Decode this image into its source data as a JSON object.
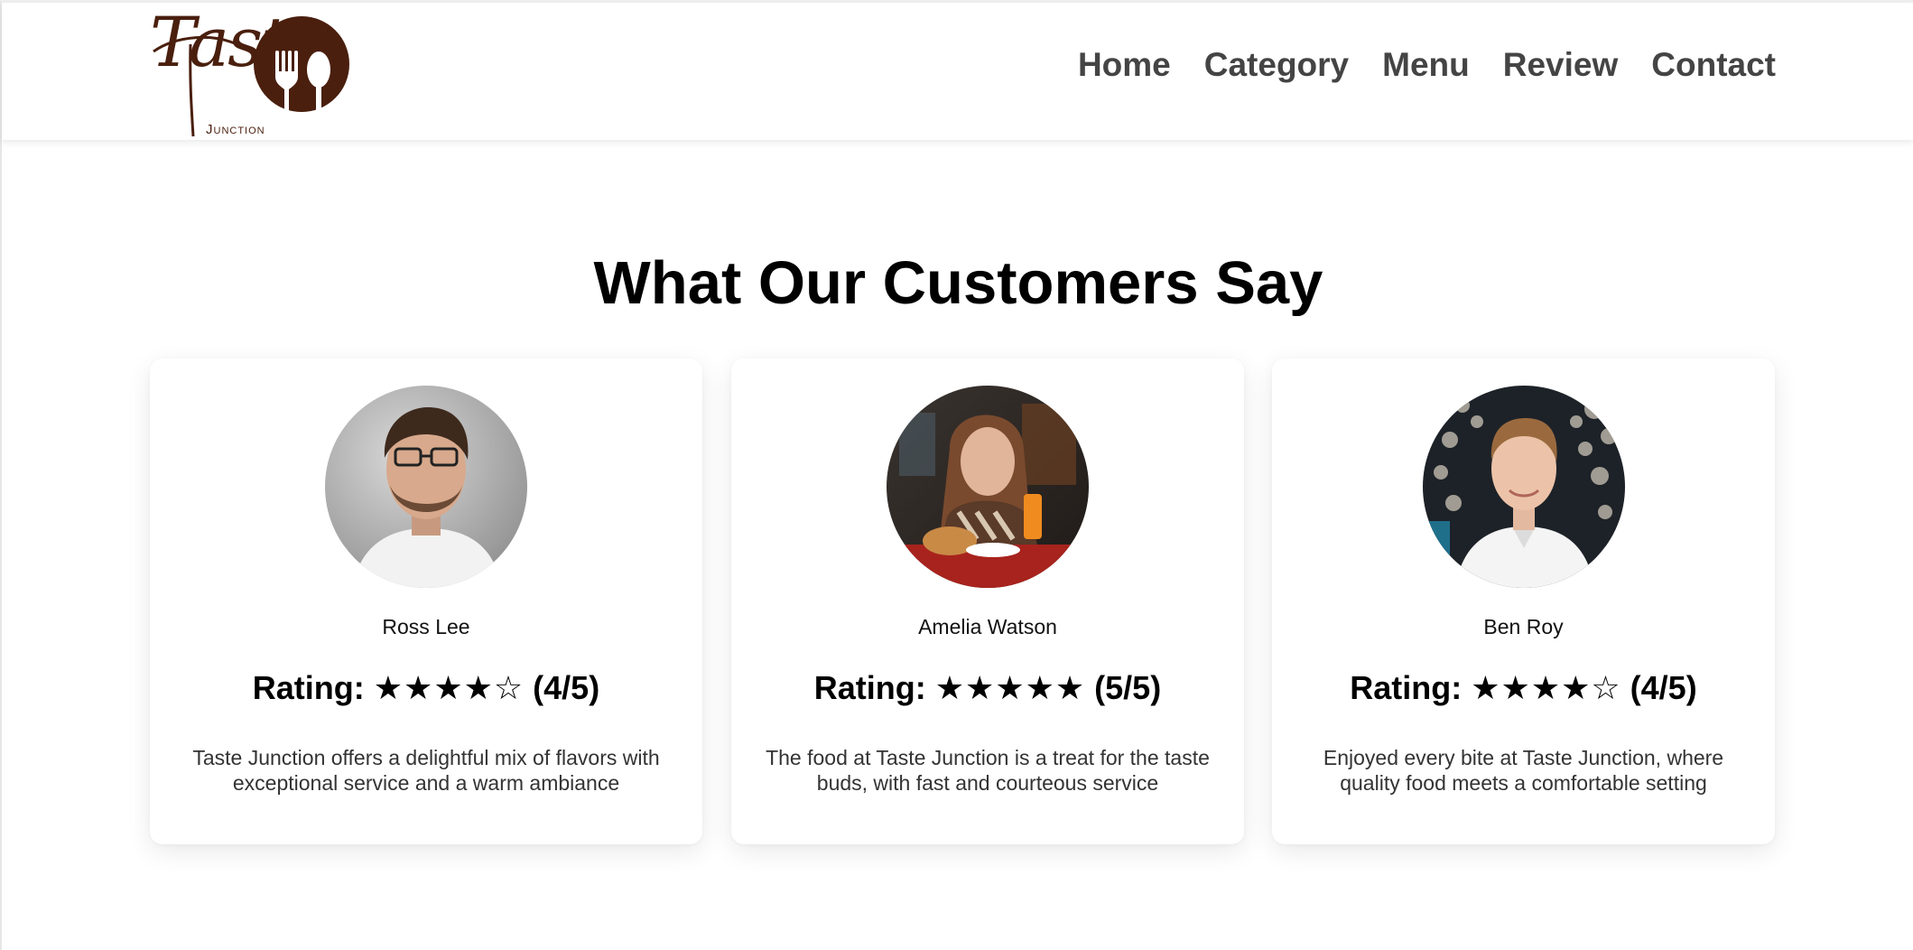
{
  "brand": {
    "logo_word": "Taste",
    "logo_sub": "Junction",
    "logo_color": "#4a1f0e",
    "logo_icon": "fork-and-spoon-icon"
  },
  "nav": {
    "items": [
      {
        "label": "Home"
      },
      {
        "label": "Category"
      },
      {
        "label": "Menu"
      },
      {
        "label": "Review"
      },
      {
        "label": "Contact"
      }
    ]
  },
  "section": {
    "title": "What Our Customers Say"
  },
  "reviews": [
    {
      "name": "Ross Lee",
      "rating_label": "Rating:",
      "stars": "★★★★☆",
      "rating_value": 4,
      "rating_max": 5,
      "score": "(4/5)",
      "text": "Taste Junction offers a delightful mix of flavors with exceptional service and a warm ambiance"
    },
    {
      "name": "Amelia Watson",
      "rating_label": "Rating:",
      "stars": "★★★★★",
      "rating_value": 5,
      "rating_max": 5,
      "score": "(5/5)",
      "text": "The food at Taste Junction is a treat for the taste buds, with fast and courteous service"
    },
    {
      "name": "Ben Roy",
      "rating_label": "Rating:",
      "stars": "★★★★☆",
      "rating_value": 4,
      "rating_max": 5,
      "score": "(4/5)",
      "text": "Enjoyed every bite at Taste Junction, where quality food meets a comfortable setting"
    }
  ]
}
